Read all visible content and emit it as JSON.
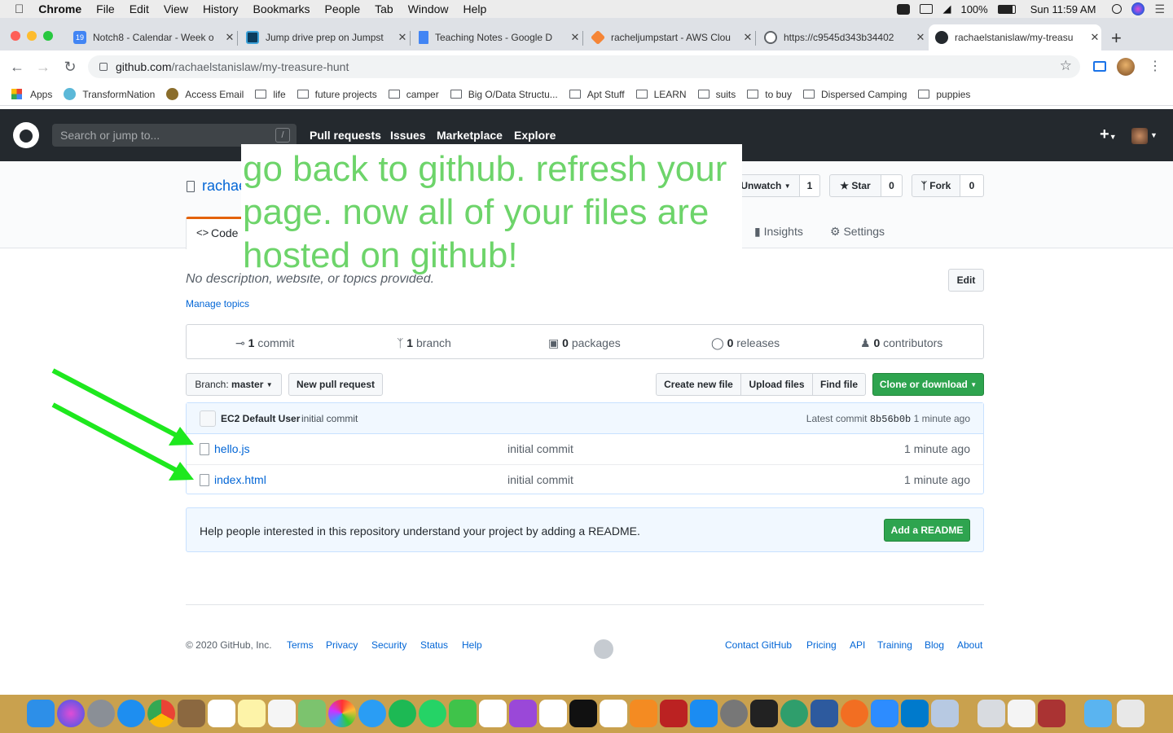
{
  "menubar": {
    "app": "Chrome",
    "items": [
      "File",
      "Edit",
      "View",
      "History",
      "Bookmarks",
      "People",
      "Tab",
      "Window",
      "Help"
    ],
    "battery": "100%",
    "clock": "Sun 11:59 AM"
  },
  "tabs": [
    {
      "title": "Notch8 - Calendar - Week o",
      "fav_color": "#4285f4",
      "fav_text": "19"
    },
    {
      "title": "Jump drive prep on Jumpst",
      "fav_color": "#0b3c5d",
      "fav_text": ""
    },
    {
      "title": "Teaching Notes - Google D",
      "fav_color": "#4285f4",
      "fav_text": ""
    },
    {
      "title": "racheljumpstart - AWS Clou",
      "fav_color": "#f58536",
      "fav_text": ""
    },
    {
      "title": "https://c9545d343b34402",
      "fav_color": "#5f6368",
      "fav_text": ""
    },
    {
      "title": "rachaelstanislaw/my-treasu",
      "fav_color": "#24292e",
      "fav_text": ""
    }
  ],
  "url": {
    "host": "github.com",
    "path": "/rachaelstanislaw/my-treasure-hunt"
  },
  "bookmarks": [
    "Apps",
    "TransformNation",
    "Access Email",
    "life",
    "future projects",
    "camper",
    "Big O/Data Structu...",
    "Apt Stuff",
    "LEARN",
    "suits",
    "to buy",
    "Dispersed Camping",
    "puppies"
  ],
  "gh": {
    "search_placeholder": "Search or jump to...",
    "slash": "/",
    "nav": [
      "Pull requests",
      "Issues",
      "Marketplace",
      "Explore"
    ]
  },
  "repo": {
    "owner_partial": "rachae",
    "unwatch": "Unwatch",
    "unwatch_count": "1",
    "star": "Star",
    "star_count": "0",
    "fork": "Fork",
    "fork_count": "0",
    "tab_code": "Code",
    "tab_insights": "Insights",
    "tab_settings": "Settings",
    "description": "No description, website, or topics provided.",
    "edit": "Edit",
    "manage_topics": "Manage topics"
  },
  "note": "go back to github. refresh your page. now all of your files are hosted on github!",
  "stats": [
    {
      "num": "1",
      "label": "commit"
    },
    {
      "num": "1",
      "label": "branch"
    },
    {
      "num": "0",
      "label": "packages"
    },
    {
      "num": "0",
      "label": "releases"
    },
    {
      "num": "0",
      "label": "contributors"
    }
  ],
  "filebar": {
    "branch_label": "Branch:",
    "branch": "master",
    "new_pr": "New pull request",
    "create": "Create new file",
    "upload": "Upload files",
    "find": "Find file",
    "clone": "Clone or download"
  },
  "commit": {
    "author": "EC2 Default User",
    "message": "initial commit",
    "latest": "Latest commit",
    "sha": "8b56b0b",
    "time": "1 minute ago"
  },
  "files": [
    {
      "name": "hello.js",
      "message": "initial commit",
      "time": "1 minute ago"
    },
    {
      "name": "index.html",
      "message": "initial commit",
      "time": "1 minute ago"
    }
  ],
  "readme": {
    "text": "Help people interested in this repository understand your project by adding a README.",
    "button": "Add a README"
  },
  "footer": {
    "copyright": "© 2020 GitHub, Inc.",
    "left_links": [
      "Terms",
      "Privacy",
      "Security",
      "Status",
      "Help"
    ],
    "right_links": [
      "Contact GitHub",
      "Pricing",
      "API",
      "Training",
      "Blog",
      "About"
    ]
  },
  "colors": {
    "arrow": "#1ee81e",
    "note_text": "#6dd46a",
    "github_dark": "#24292e",
    "link": "#0366d6",
    "green_button": "#2ea44f"
  }
}
